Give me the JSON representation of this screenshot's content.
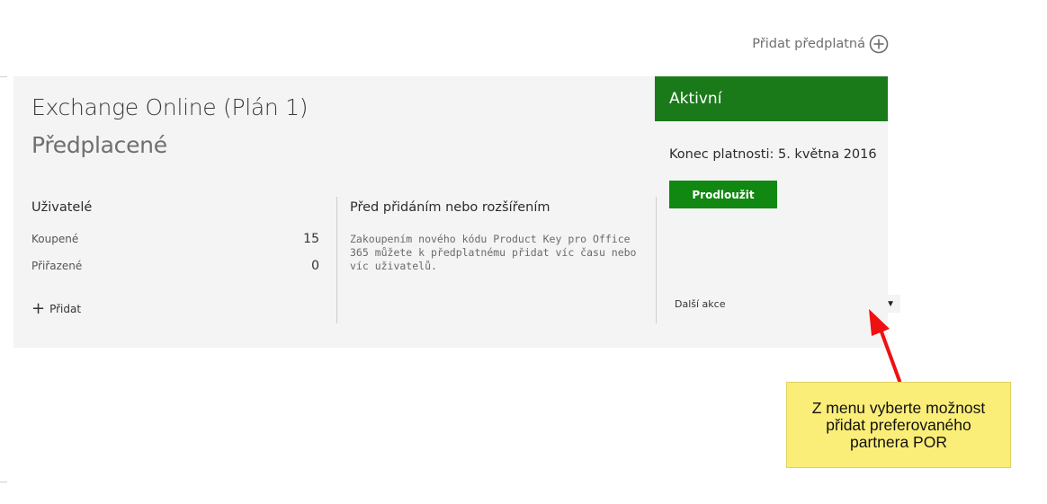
{
  "header": {
    "add_subscription_label": "Přidat předplatná",
    "add_subscription_icon": "plus-circle-icon"
  },
  "subscription": {
    "title": "Exchange Online (Plán 1)",
    "subtitle": "Předplacené",
    "users": {
      "heading": "Uživatelé",
      "bought_label": "Koupené",
      "bought_value": "15",
      "assigned_label": "Přiřazené",
      "assigned_value": "0",
      "add_label": "Přidat",
      "add_icon": "plus-icon"
    },
    "info": {
      "heading": "Před přidáním nebo rozšířením",
      "text": "Zakoupením nového kódu Product Key pro Office 365 můžete k předplatnému přidat víc času nebo víc uživatelů."
    },
    "status": {
      "label": "Aktivní",
      "expiry": "Konec platnosti: 5. května 2016",
      "renew_label": "Prodloužit",
      "more_actions_label": "Další akce",
      "more_actions_icon": "dropdown-arrow-icon"
    }
  },
  "annotation": {
    "callout_text": "Z menu vyberte možnost přidat preferovaného partnera POR",
    "arrow_icon": "red-arrow-icon"
  },
  "colors": {
    "status_green": "#1a7a1a",
    "button_green": "#118811",
    "card_background": "#f4f4f4",
    "callout_yellow": "#fbee78",
    "arrow_red": "#ee1111"
  }
}
